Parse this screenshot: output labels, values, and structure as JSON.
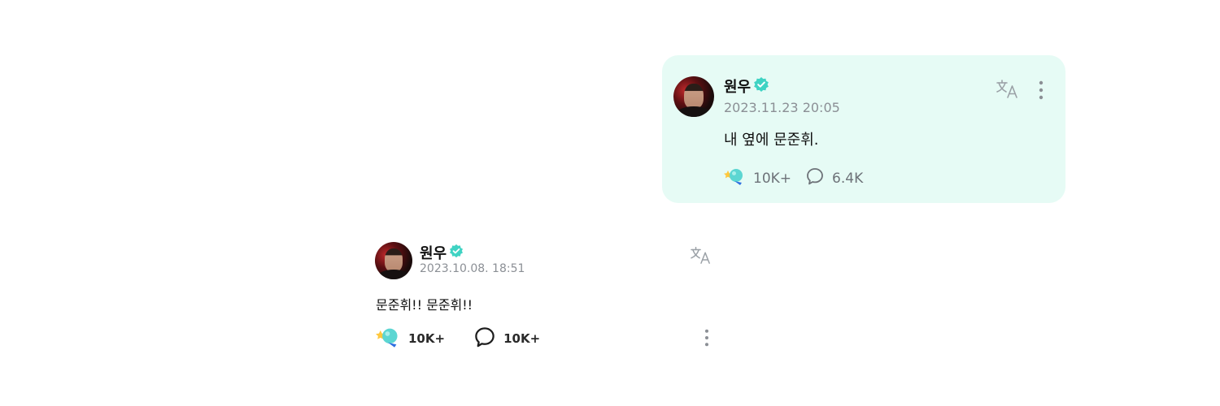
{
  "posts": [
    {
      "author": "원우",
      "timestamp": "2023.11.23 20:05",
      "content": "내 옆에 문준휘.",
      "likes": "10K+",
      "comments": "6.4K",
      "highlighted": true
    },
    {
      "author": "원우",
      "timestamp": "2023.10.08. 18:51",
      "content": "문준휘!! 문준휘!!",
      "likes": "10K+",
      "comments": "10K+",
      "highlighted": false
    }
  ],
  "colors": {
    "highlight_bg": "#e6fbf5",
    "verified": "#3fd3c3",
    "muted": "#8b8f95"
  },
  "icons": [
    "verified-badge-icon",
    "translate-icon",
    "more-options-icon",
    "lightbulb-like-icon",
    "comment-bubble-icon"
  ]
}
